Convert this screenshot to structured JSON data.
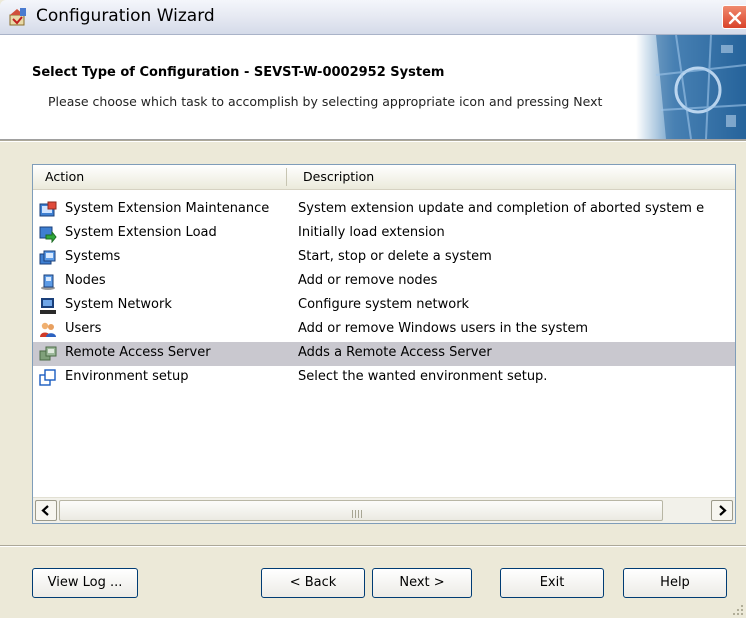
{
  "window": {
    "title": "Configuration Wizard"
  },
  "header": {
    "title": "Select Type of Configuration - SEVST-W-0002952 System",
    "subtitle": "Please choose which task to accomplish by selecting appropriate icon and pressing Next"
  },
  "list": {
    "columns": {
      "action": "Action",
      "description": "Description"
    },
    "selected_index": 6,
    "rows": [
      {
        "action": "System Extension Maintenance",
        "description": "System extension update and completion of aborted system e",
        "icon": "maintenance-icon"
      },
      {
        "action": "System Extension Load",
        "description": "Initially load extension",
        "icon": "extension-load-icon"
      },
      {
        "action": "Systems",
        "description": "Start, stop or delete a system",
        "icon": "systems-icon"
      },
      {
        "action": "Nodes",
        "description": "Add or remove nodes",
        "icon": "nodes-icon"
      },
      {
        "action": "System Network",
        "description": "Configure system network",
        "icon": "network-icon"
      },
      {
        "action": "Users",
        "description": "Add or remove Windows users in the system",
        "icon": "users-icon"
      },
      {
        "action": "Remote Access Server",
        "description": "Adds a Remote Access Server",
        "icon": "remote-access-icon"
      },
      {
        "action": "Environment setup",
        "description": "Select the wanted environment setup.",
        "icon": "environment-icon"
      }
    ]
  },
  "buttons": {
    "view_log": "View Log ...",
    "back": "< Back",
    "next": "Next >",
    "exit": "Exit",
    "help": "Help"
  },
  "colors": {
    "selection": "#c9c8cf",
    "dialog_bg": "#ece9d8",
    "button_border": "#003c74"
  }
}
